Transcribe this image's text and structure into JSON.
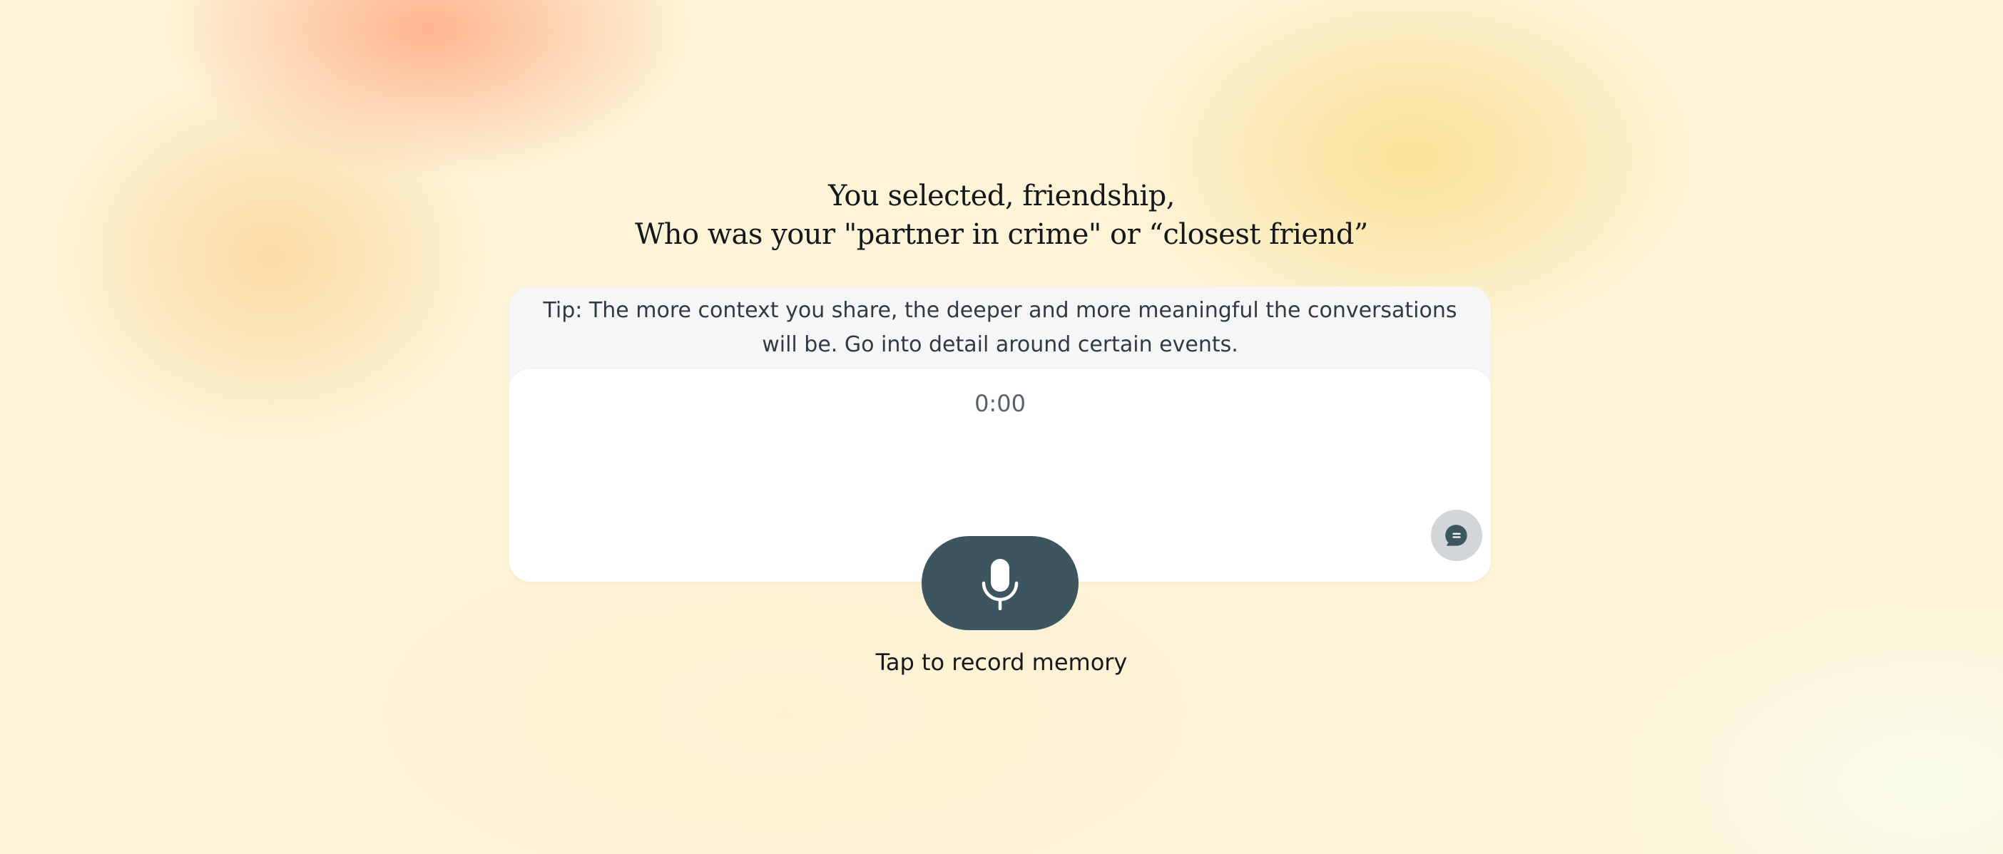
{
  "prompt": {
    "line1": "You selected, friendship,",
    "line2": "Who was your \"partner in crime\" or “closest friend”"
  },
  "tip": {
    "text": "Tip: The more context you share, the deeper and more meaningful the conversations will be. Go into detail around certain events."
  },
  "recorder": {
    "timer": "0:00",
    "caption": "Tap to record memory",
    "mic_icon": "microphone-icon",
    "chat_icon": "chat-bubble-icon"
  },
  "colors": {
    "primary": "#3d555e",
    "chat_button_bg": "#d2d6d8",
    "text_dark": "#15191c",
    "tip_text": "#2f3b43",
    "timer_text": "#56636b"
  }
}
